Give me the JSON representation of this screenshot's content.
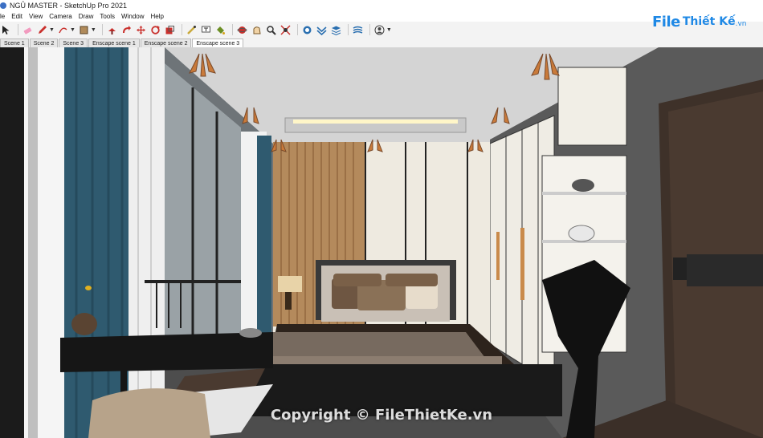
{
  "window": {
    "title": "NGỦ MASTER - SketchUp Pro 2021"
  },
  "menu": {
    "items": [
      "le",
      "Edit",
      "View",
      "Camera",
      "Draw",
      "Tools",
      "Window",
      "Help"
    ]
  },
  "toolbar": {
    "tools": [
      "select-icon",
      "eraser-icon",
      "pencil-icon",
      "arc-icon",
      "rectangle-icon",
      "push-pull-icon",
      "follow-me-icon",
      "move-icon",
      "rotate-icon",
      "scale-icon",
      "tape-measure-icon",
      "text-icon",
      "paint-bucket-icon",
      "orbit-icon",
      "pan-icon",
      "zoom-icon",
      "zoom-extents-icon",
      "warehouse-icon",
      "extension-icon",
      "layers-icon",
      "sandbox-icon",
      "account-icon"
    ]
  },
  "scenes": {
    "tabs": [
      "Scene 1",
      "Scene 2",
      "Scene 3",
      "Enscape scene 1",
      "Enscape scene 2",
      "Enscape scene 3"
    ],
    "active_index": 5
  },
  "logo": {
    "file": "File",
    "rest": "Thiết Kế",
    "vn": ".vn"
  },
  "watermark": {
    "text": "Copyright © FileThietKe.vn"
  },
  "colors": {
    "accent": "#1e88e5",
    "curtain": "#2f5a6f",
    "wood": "#6b4a2e",
    "ceiling": "#d9d9d9"
  }
}
